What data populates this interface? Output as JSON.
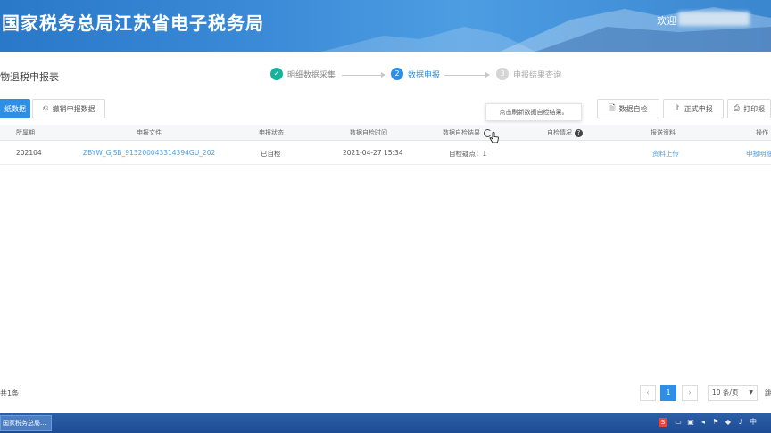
{
  "header": {
    "title": "国家税务总局江苏省电子税务局",
    "welcome": "欢迎"
  },
  "page": {
    "title": "物退税申报表"
  },
  "steps": [
    {
      "label": "明细数据采集",
      "number": "✓"
    },
    {
      "label": "数据申报",
      "number": "2"
    },
    {
      "label": "申报结果查询",
      "number": "3"
    }
  ],
  "toolbar": {
    "left_button": "纸数据",
    "import_button": "撤销申报数据",
    "check_button": "数据自检",
    "formal_button": "正式申报",
    "print_button": "打印报"
  },
  "tooltip": "点击刷新数据自检结果。",
  "table": {
    "headers": [
      "所属期",
      "申报文件",
      "申报状态",
      "数据自检时间",
      "数据自检结果",
      "自检情况",
      "报送资料",
      "操作"
    ],
    "rows": [
      {
        "period": "202104",
        "file": "ZBYW_GJSB_913200043314394GU_202",
        "status": "已自检",
        "check_time": "2021-04-27 15:34",
        "check_result": "自检疑点：1",
        "situation": "",
        "materials": "资料上传",
        "action": "申报明细"
      }
    ]
  },
  "footer": {
    "total": "共1条",
    "current_page": "1",
    "page_size": "10 条/页",
    "goto": "跳"
  },
  "taskbar": {
    "item": "国家税务总局..."
  },
  "colors": {
    "primary": "#2f8fe6",
    "step_done": "#19b19b",
    "header": "#3b8bd8"
  }
}
